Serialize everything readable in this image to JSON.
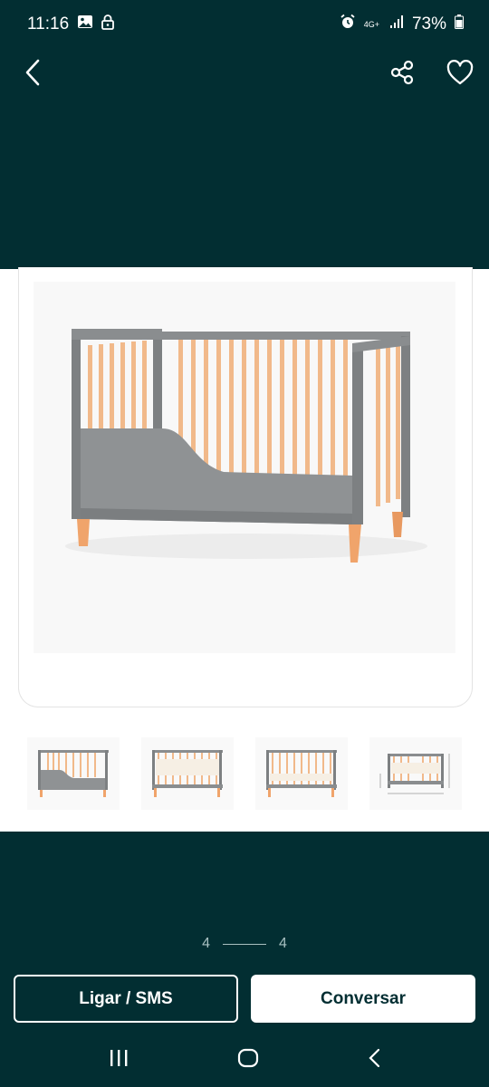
{
  "status_bar": {
    "time": "11:16",
    "network": "4G+",
    "battery": "73%"
  },
  "icons": {
    "back": "chevron-left-icon",
    "share": "share-icon",
    "favorite": "heart-icon",
    "gallery_photo": "image-icon",
    "lock": "lock-icon",
    "alarm": "alarm-icon",
    "signal": "signal-icon",
    "battery": "battery-icon"
  },
  "gallery": {
    "current": "4",
    "total": "4",
    "thumbnails": [
      "crib-side-view",
      "crib-front-view",
      "crib-front-view-2",
      "crib-dimensions"
    ]
  },
  "actions": {
    "call_label": "Ligar / SMS",
    "chat_label": "Conversar"
  },
  "colors": {
    "background": "#022e32",
    "crib_gray": "#8a8d8f",
    "wood": "#f1b98a",
    "button_text": "#022e32"
  }
}
